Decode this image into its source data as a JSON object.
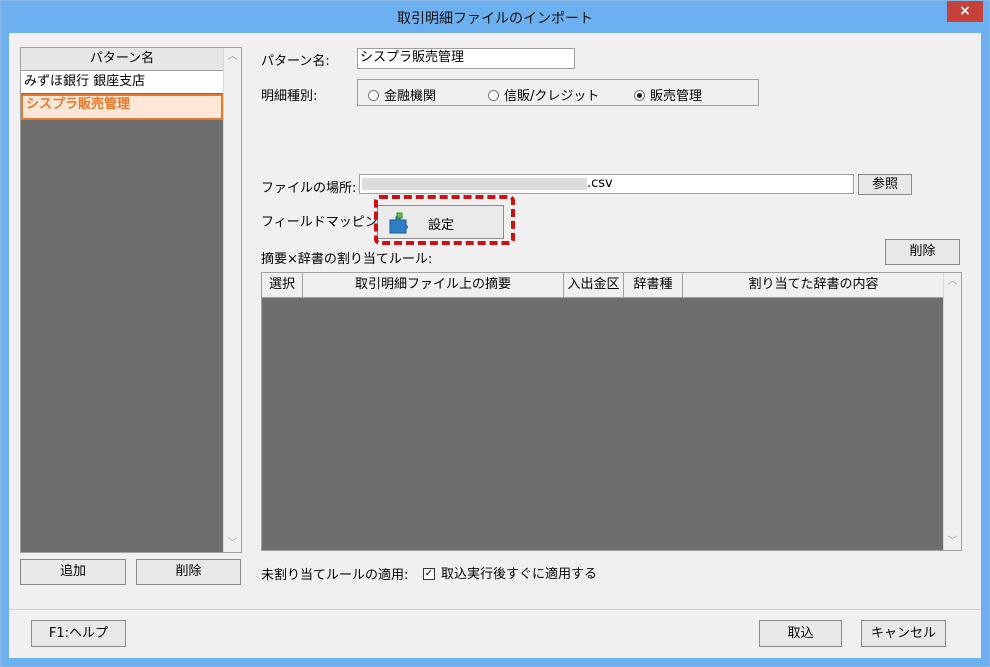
{
  "window": {
    "title": "取引明細ファイルのインポート",
    "close_label": "×"
  },
  "pattern_list": {
    "header": "パターン名",
    "items": [
      {
        "label": "みずほ銀行 銀座支店",
        "selected": false
      },
      {
        "label": "シスプラ販売管理",
        "selected": true
      }
    ],
    "add_label": "追加",
    "delete_label": "削除"
  },
  "form": {
    "pattern_name_label": "パターン名:",
    "pattern_name_value": "シスプラ販売管理",
    "detail_type_label": "明細種別:",
    "detail_types": [
      {
        "label": "金融機関",
        "checked": false
      },
      {
        "label": "信販/クレジット",
        "checked": false
      },
      {
        "label": "販売管理",
        "checked": true
      }
    ],
    "file_location_label": "ファイルの場所:",
    "file_location_value": ".csv",
    "browse_label": "参照",
    "field_mapping_label": "フィールドマッピング:",
    "mapping_button_label": "設定",
    "rules_label": "摘要×辞書の割り当てルール:",
    "rules_delete_label": "削除"
  },
  "rules_table": {
    "columns": [
      "選択",
      "取引明細ファイル上の摘要",
      "入出金区",
      "辞書種",
      "割り当てた辞書の内容"
    ],
    "rows": []
  },
  "unassigned": {
    "label": "未割り当てルールの適用:",
    "checkbox_label": "取込実行後すぐに適用する",
    "checked": true
  },
  "footer": {
    "help_label": "F1:ヘルプ",
    "import_label": "取込",
    "cancel_label": "キャンセル"
  },
  "colors": {
    "titlebar": "#6db0ef",
    "close": "#c7413b",
    "selected_item": "#e8772e",
    "highlight": "#cc1111"
  }
}
